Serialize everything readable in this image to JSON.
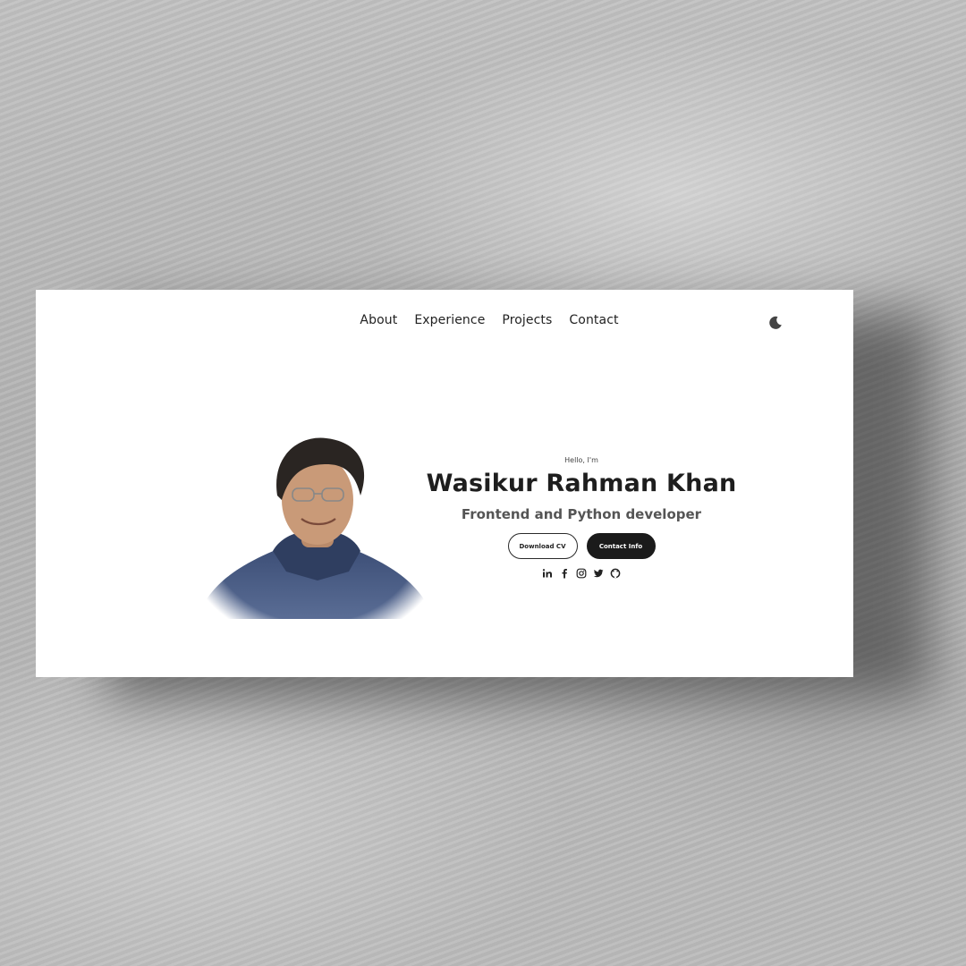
{
  "nav": {
    "items": [
      {
        "label": "About"
      },
      {
        "label": "Experience"
      },
      {
        "label": "Projects"
      },
      {
        "label": "Contact"
      }
    ],
    "theme_toggle_icon": "moon-icon"
  },
  "hero": {
    "greeting": "Hello, I'm",
    "name": "Wasikur Rahman Khan",
    "role": "Frontend and Python developer",
    "buttons": {
      "download_cv": "Download CV",
      "contact_info": "Contact Info"
    },
    "socials": [
      "linkedin-icon",
      "facebook-icon",
      "instagram-icon",
      "twitter-icon",
      "github-icon"
    ]
  },
  "colors": {
    "card_background": "#ffffff",
    "primary_text": "#1e1e1e",
    "secondary_text": "#555555",
    "solid_button": "#1b1b1b",
    "backdrop": "#bcbcbc"
  }
}
